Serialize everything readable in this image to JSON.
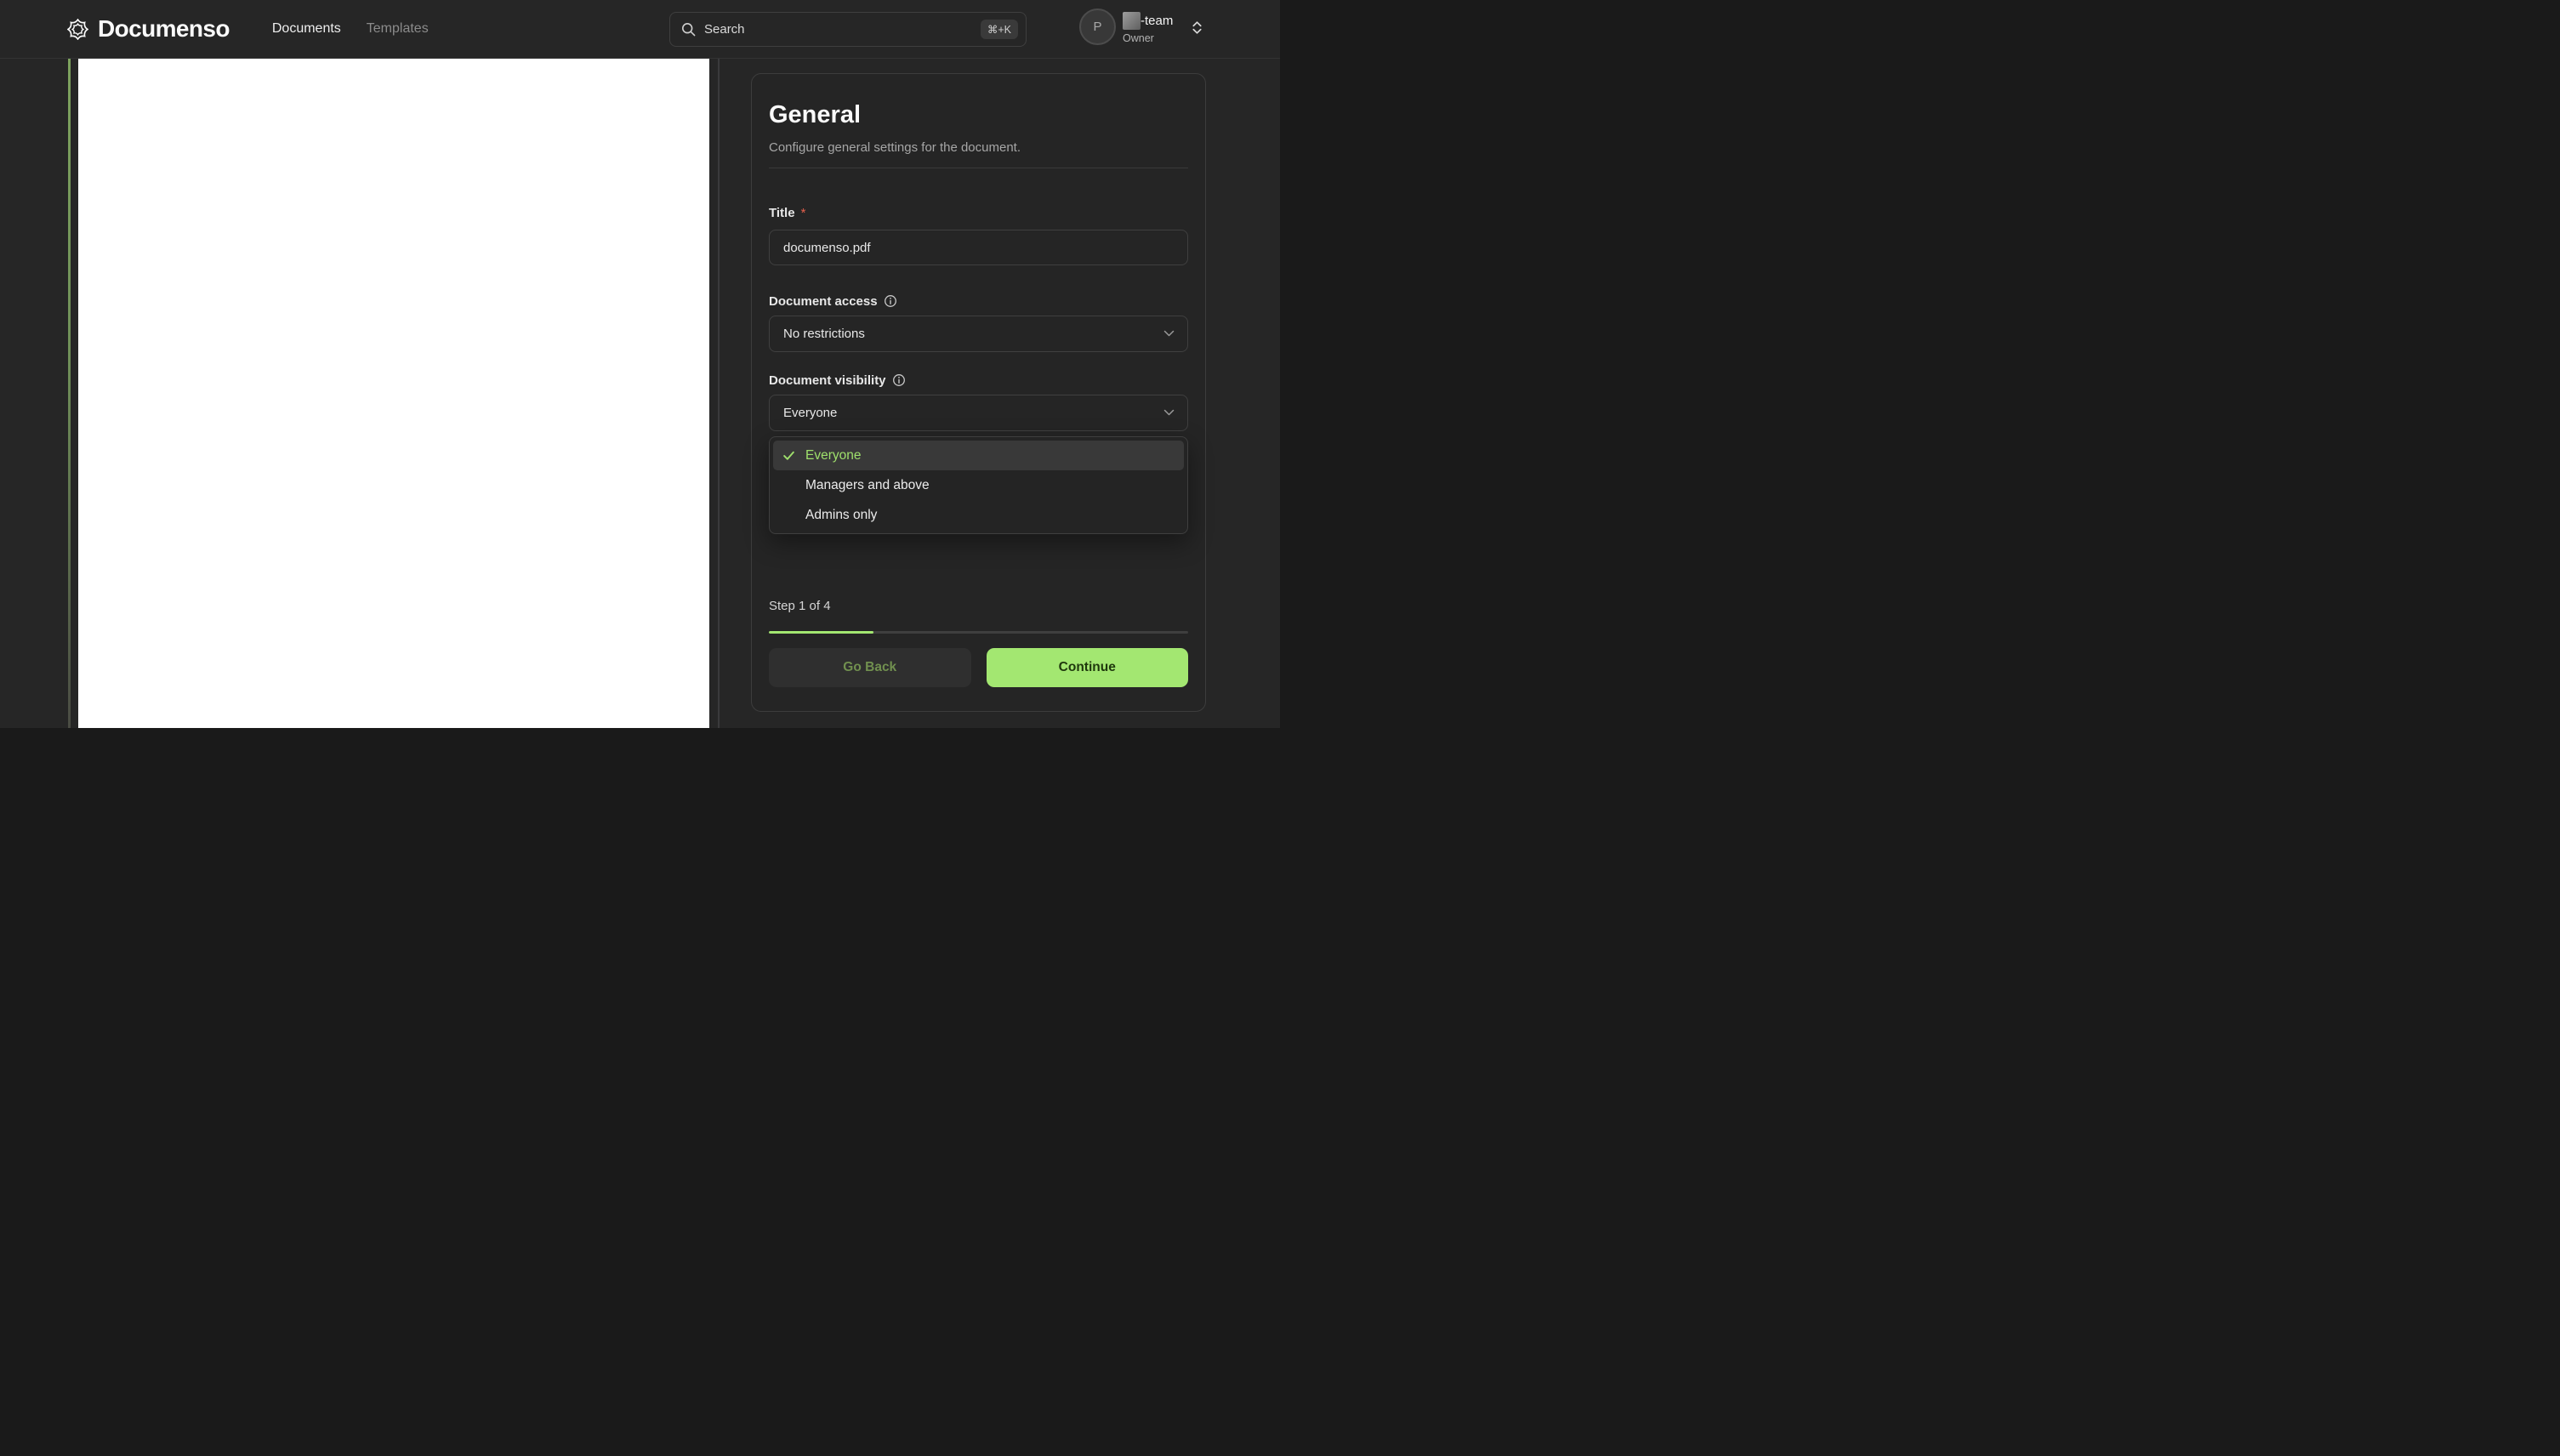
{
  "header": {
    "brand": "Documenso",
    "nav": {
      "documents": "Documents",
      "templates": "Templates"
    },
    "search": {
      "placeholder": "Search",
      "shortcut": "⌘+K"
    },
    "user": {
      "initial": "P",
      "team_name_suffix": "-team",
      "role": "Owner"
    }
  },
  "panel": {
    "title": "General",
    "subtitle": "Configure general settings for the document.",
    "title_field": {
      "label": "Title",
      "required_marker": "*",
      "value": "documenso.pdf"
    },
    "access_field": {
      "label": "Document access",
      "value": "No restrictions"
    },
    "visibility_field": {
      "label": "Document visibility",
      "value": "Everyone"
    },
    "visibility_options": [
      {
        "label": "Everyone",
        "selected": true
      },
      {
        "label": "Managers and above",
        "selected": false
      },
      {
        "label": "Admins only",
        "selected": false
      }
    ],
    "footer": {
      "step_text": "Step 1 of 4",
      "progress_percent": 25,
      "go_back": "Go Back",
      "continue": "Continue"
    }
  },
  "colors": {
    "accent_green": "#a3e771",
    "selected_option_green": "#9fe06c",
    "required_red": "#e5604c",
    "background": "#262626"
  }
}
